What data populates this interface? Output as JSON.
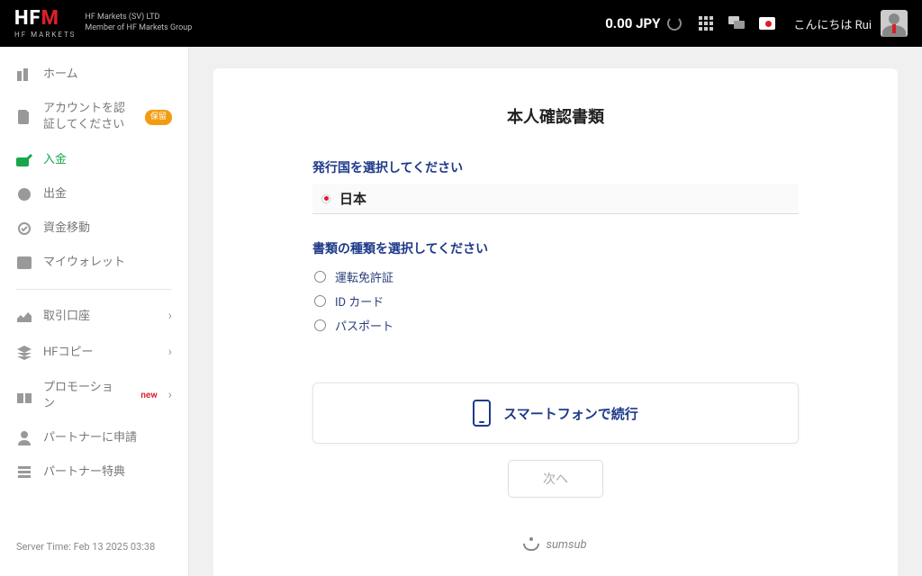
{
  "header": {
    "brand_main": "HF",
    "brand_accent": "M",
    "brand_sub": "HF MARKETS",
    "company_line1": "HF Markets (SV) LTD",
    "company_line2": "Member of HF Markets Group",
    "balance": "0.00 JPY",
    "greeting": "こんにちは Rui"
  },
  "sidebar": {
    "items": [
      {
        "label": "ホーム"
      },
      {
        "label": "アカウントを認証してください",
        "badge": "保留"
      },
      {
        "label": "入金"
      },
      {
        "label": "出金"
      },
      {
        "label": "資金移動"
      },
      {
        "label": "マイウォレット"
      }
    ],
    "items2": [
      {
        "label": "取引口座"
      },
      {
        "label": "HFコピー"
      },
      {
        "label": "プロモーション",
        "tag": "new"
      },
      {
        "label": "パートナーに申請"
      },
      {
        "label": "パートナー特典"
      }
    ],
    "server_time": "Server Time: Feb 13 2025 03:38"
  },
  "main": {
    "title": "本人確認書類",
    "country_label": "発行国を選択してください",
    "country_value": "日本",
    "doc_label": "書類の種類を選択してください",
    "doc_options": [
      "運転免許証",
      "ID カード",
      "パスポート"
    ],
    "phone_cta": "スマートフォンで続行",
    "next": "次へ",
    "provider": "sumsub"
  }
}
